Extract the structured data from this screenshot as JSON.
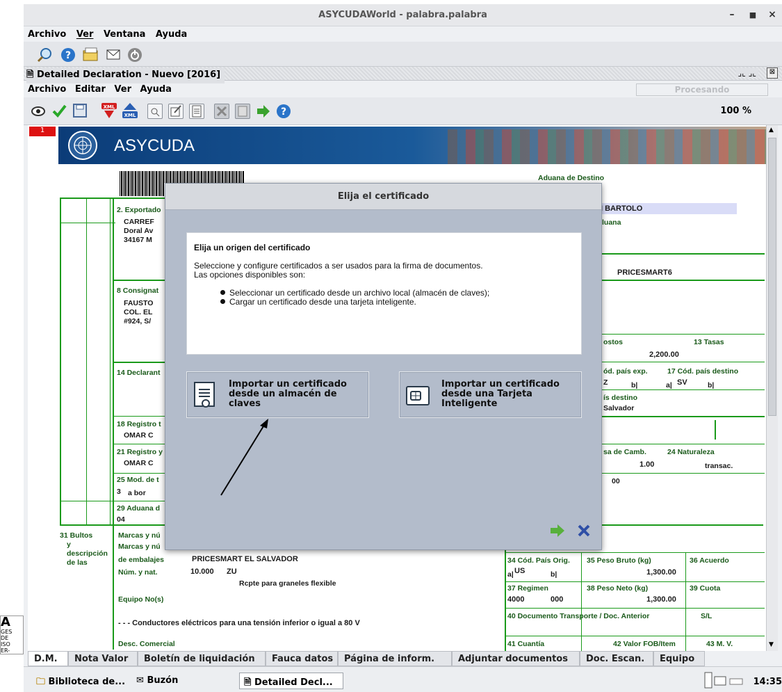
{
  "window": {
    "title": "ASYCUDAWorld - palabra.palabra"
  },
  "main_menu": [
    "Archivo",
    "Ver",
    "Ventana",
    "Ayuda"
  ],
  "inner_window": {
    "title": "Detailed Declaration - Nuevo [2016]"
  },
  "inner_menu": [
    "Archivo",
    "Editar",
    "Ver",
    "Ayuda"
  ],
  "status": "Procesando",
  "zoom": "100 %",
  "page_indicator": "1",
  "banner": {
    "brand": "ASYCUDA"
  },
  "form": {
    "aduana_destino": "Aduana de Destino",
    "bartolo": "I BARTOLO",
    "luana": "luana",
    "pricesmart6": "PRICESMART6",
    "f2": "2. Exportado",
    "carref": "CARREF",
    "doral": "Doral Av",
    "m34167": "34167 M",
    "f8": "8 Consignat",
    "fausto": "FAUSTO",
    "colel": "COL. EL",
    "n924": "#924, S/",
    "ostos": "ostos",
    "tasas": "13 Tasas",
    "v2200": "2,200.00",
    "f14": "14 Declarant",
    "odpaisexp": "ód. país exp.",
    "f17": "17 Cód. país destino",
    "z": "Z",
    "b1": "b|",
    "a1": "a|",
    "sv": "SV",
    "b2": "b|",
    "isdestino": "ís destino",
    "salvador": "Salvador",
    "f18": "18 Registro t",
    "omar1": "OMAR C",
    "f21": "21 Registro y",
    "omar2": "OMAR C",
    "sacamb": "sa de Camb.",
    "f24": "24 Naturaleza",
    "v100": "1.00",
    "transac": "transac.",
    "f25": "25 Mod. de t",
    "v3": "3",
    "abor": "a bor",
    "v00": "00",
    "f29": "29 Aduana d",
    "v04": "04",
    "f31": "31 Bultos",
    "y": "y",
    "descripcion": "descripción",
    "delas": "de las",
    "marcas1": "Marcas y nú",
    "marcas2": "Marcas y nú",
    "embalajes": "de embalajes",
    "pricesmart_sv": "PRICESMART EL SALVADOR",
    "numynat": "Núm. y nat.",
    "v10000": "10.000",
    "zu": "ZU",
    "rcpte": "Rcpte para graneles flexible",
    "equipo": "Equipo No(s)",
    "conductores": "- - - Conductores eléctricos para una tensión inferior o igual a 80 V",
    "desccomercial": "Desc. Comercial",
    "f34": "34 Cód. País Orig.",
    "us": "US",
    "a2": "a|",
    "b3": "b|",
    "f35": "35 Peso Bruto (kg)",
    "f36": "36 Acuerdo",
    "v1300a": "1,300.00",
    "f37": "37 Regimen",
    "v4000": "4000",
    "v000": "000",
    "f38": "38 Peso Neto (kg)",
    "f39": "39 Cuota",
    "v1300b": "1,300.00",
    "f40": "40 Documento Transporte / Doc. Anterior",
    "sl": "S/L",
    "f41": "41 Cuantía",
    "f42": "42 Valor FOB/Item",
    "f43": "43 M. V."
  },
  "dialog": {
    "title": "Elija el certificado",
    "heading": "Elija un origen del certificado",
    "para1": "Seleccione y configure certificados a ser usados para la firma de documentos.",
    "para2": "Las opciones disponibles son:",
    "bullet1": "Seleccionar un certificado desde un archivo local (almacén de claves);",
    "bullet2": "Cargar un certificado desde una tarjeta inteligente.",
    "option1": "Importar un certificado desde un almacén de claves",
    "option2": "Importar un certificado desde una Tarjeta Inteligente"
  },
  "tabs": [
    "D.M.",
    "Nota Valor",
    "Boletín de liquidación",
    "Fauca datos",
    "Página de inform.",
    "Adjuntar documentos",
    "Doc. Escan.",
    "Equipo"
  ],
  "taskbar": {
    "items": [
      "Biblioteca de...",
      "Buzón",
      "Detailed Decl..."
    ],
    "clock": "14:35"
  },
  "left_chip": [
    "A",
    "GES",
    "DE",
    "ISO",
    "ER-"
  ]
}
